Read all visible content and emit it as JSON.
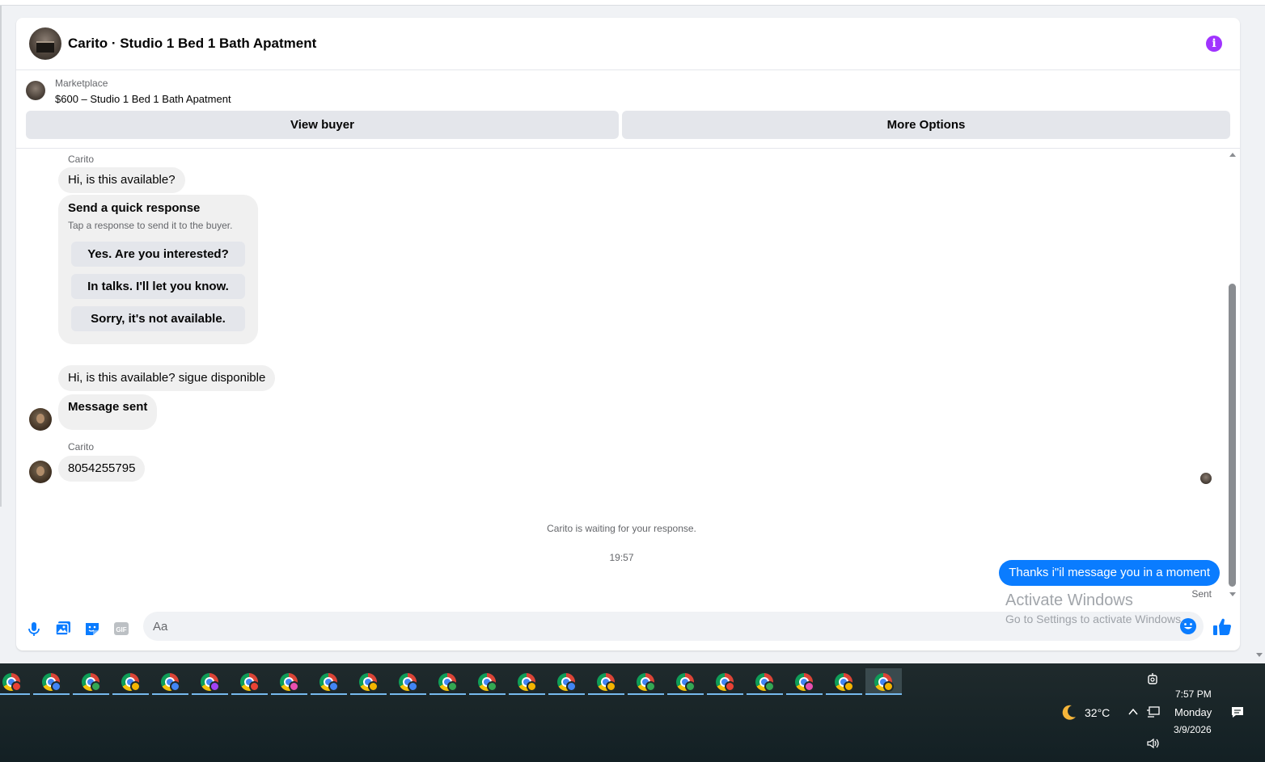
{
  "header": {
    "title": "Carito · Studio 1 Bed 1 Bath Apatment"
  },
  "marketplace": {
    "label": "Marketplace",
    "listing": "$600 – Studio 1 Bed 1 Bath Apatment",
    "view_buyer": "View buyer",
    "more_options": "More Options"
  },
  "messages": {
    "sender_name": "Carito",
    "msg1": "Hi, is this available?",
    "quick_response": {
      "title": "Send a quick response",
      "subtitle": "Tap a response to send it to the buyer.",
      "options": [
        "Yes. Are you interested?",
        "In talks. I'll let you know.",
        "Sorry, it's not available."
      ]
    },
    "msg2": "Hi, is this available? sigue disponible",
    "msg3": "Message sent",
    "sender_name2": "Carito",
    "msg4": "8054255795",
    "waiting": "Carito is waiting for your response.",
    "timestamp": "19:57",
    "outgoing": "Thanks i\"il message you in a moment",
    "status": "Sent"
  },
  "composer": {
    "placeholder": "Aa"
  },
  "watermark": {
    "line1": "Activate Windows",
    "line2": "Go to Settings to activate Windows."
  },
  "taskbar": {
    "chrome_windows": 23,
    "profile_colors": [
      "#e94235",
      "#4285f4",
      "#34a853",
      "#f4b400",
      "#4285f4",
      "#a142f4",
      "#e94235",
      "#e94fb0",
      "#4285f4",
      "#f4b400",
      "#4285f4",
      "#34a853",
      "#34a853",
      "#f4b400",
      "#4285f4",
      "#f4b400",
      "#34a853",
      "#34a853",
      "#e94235",
      "#34a853",
      "#e94fb0",
      "#f4b400",
      "#f4b400"
    ],
    "temperature": "32°C",
    "time": "7:57 PM",
    "day": "Monday",
    "date": "3/9/2026"
  },
  "colors": {
    "accent_blue": "#0a7cff",
    "info_purple": "#a033ff"
  }
}
